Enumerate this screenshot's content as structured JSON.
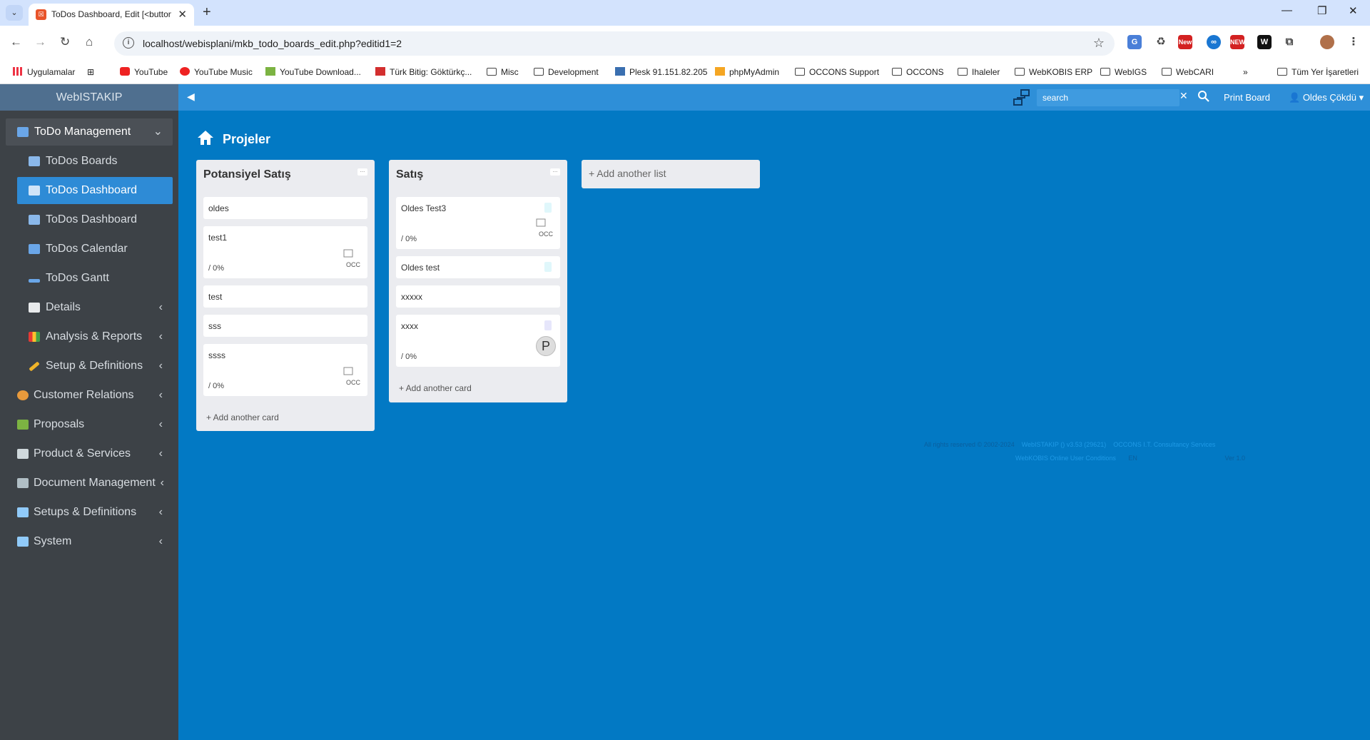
{
  "browser": {
    "tab_title": "ToDos Dashboard, Edit [<button",
    "url": "localhost/webisplani/mkb_todo_boards_edit.php?editid1=2",
    "bookmarks": {
      "apps": "Uygulamalar",
      "youtube": "YouTube",
      "youtube_music": "YouTube Music",
      "youtube_download": "YouTube Download...",
      "turk_bitig": "Türk Bitig: Göktürkç...",
      "misc": "Misc",
      "development": "Development",
      "plesk": "Plesk 91.151.82.205",
      "phpmyadmin": "phpMyAdmin",
      "occons_support": "OCCONS Support",
      "occons": "OCCONS",
      "ihaleler": "Ihaleler",
      "webkobis_erp": "WebKOBIS ERP",
      "webigs": "WebIGS",
      "webcari": "WebCARI",
      "all_bookmarks": "Tüm Yer İşaretleri"
    },
    "ext_badges": {
      "new1": "New",
      "new2": "NEW",
      "w": "W"
    }
  },
  "app": {
    "brand": "WebISTAKIP",
    "search_placeholder": "search",
    "print_board": "Print Board",
    "user": "Oldes Çökdü"
  },
  "sidebar": {
    "items": [
      {
        "label": "ToDo Management",
        "icon": "table-icon",
        "expanded": true
      },
      {
        "label": "ToDos Boards",
        "icon": "table-icon"
      },
      {
        "label": "ToDos Dashboard",
        "icon": "table-icon",
        "active": true
      },
      {
        "label": "ToDos Dashboard",
        "icon": "table-icon"
      },
      {
        "label": "ToDos Calendar",
        "icon": "calendar-icon"
      },
      {
        "label": "ToDos Gantt",
        "icon": "gantt-icon"
      },
      {
        "label": "Details",
        "icon": "calendar-page-icon"
      },
      {
        "label": "Analysis & Reports",
        "icon": "bar-chart-icon"
      },
      {
        "label": "Setup & Definitions",
        "icon": "wrench-icon"
      },
      {
        "label": "Customer Relations",
        "icon": "people-icon"
      },
      {
        "label": "Proposals",
        "icon": "proposal-icon"
      },
      {
        "label": "Product & Services",
        "icon": "product-icon"
      },
      {
        "label": "Document Management",
        "icon": "document-icon"
      },
      {
        "label": "Setups & Definitions",
        "icon": "tools-icon"
      },
      {
        "label": "System",
        "icon": "tools-icon"
      }
    ]
  },
  "board": {
    "title": "Projeler",
    "lists": [
      {
        "title": "Potansiyel Satış",
        "menu": "...",
        "cards": [
          {
            "title": "oldes"
          },
          {
            "title": "test1",
            "progress": "/ 0%",
            "avatar_alt": "OCC"
          },
          {
            "title": "test"
          },
          {
            "title": "sss"
          },
          {
            "title": "ssss",
            "progress": "/ 0%",
            "avatar_alt": "OCC"
          }
        ],
        "add_card": "+ Add another card"
      },
      {
        "title": "Satış",
        "menu": "...",
        "cards": [
          {
            "title": "Oldes Test3",
            "progress": "/ 0%",
            "avatar_alt": "OCC",
            "badge_color": "#e0f7fb"
          },
          {
            "title": "Oldes test",
            "badge_color": "#e0f7fb"
          },
          {
            "title": "xxxxx"
          },
          {
            "title": "xxxx",
            "progress": "/ 0%",
            "avatar_letter": "P",
            "badge_color": "#e6e6fb"
          }
        ],
        "add_card": "+ Add another card"
      }
    ],
    "add_list": "+ Add another list"
  },
  "footer": {
    "line1_a": "All rights reserved © 2002-2024",
    "line1_b": "WebISTAKIP () v3.53 (29621)",
    "line1_c": "OCCONS I.T. Consultancy Services",
    "line2_a": "WebKOBIS Online User Conditions",
    "line2_b": "EN",
    "line2_c": "Ver 1.0"
  },
  "colors": {
    "content_bg": "#0279c4",
    "topbar": "#2e8fd8",
    "sidebar_bg": "#3d4247",
    "active_item": "#2e8bd6",
    "list_bg": "#ebecf0"
  }
}
